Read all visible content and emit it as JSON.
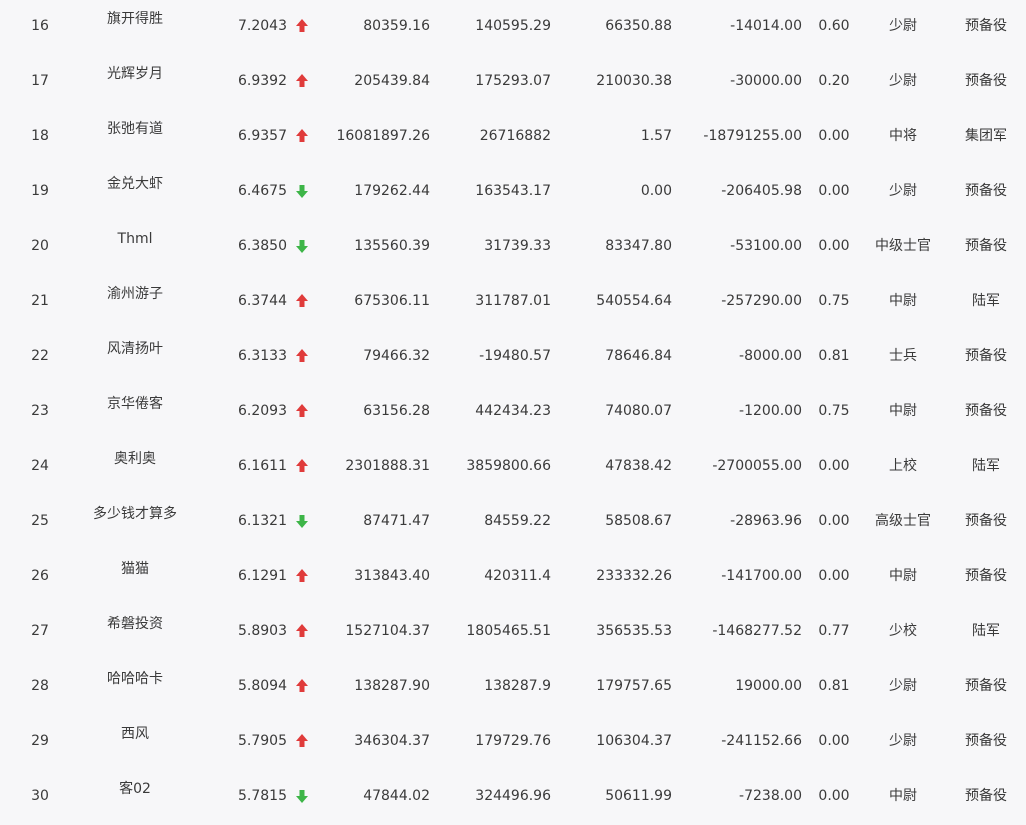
{
  "colors": {
    "up": "#e03b3b",
    "down": "#3db548"
  },
  "rows": [
    {
      "rank": "16",
      "name": "旗开得胜",
      "score": "7.2043",
      "trend": "up",
      "v1": "80359.16",
      "v2": "140595.29",
      "v3": "66350.88",
      "v4": "-14014.00",
      "ratio": "0.60",
      "rank_title": "少尉",
      "unit": "预备役"
    },
    {
      "rank": "17",
      "name": "光辉岁月",
      "score": "6.9392",
      "trend": "up",
      "v1": "205439.84",
      "v2": "175293.07",
      "v3": "210030.38",
      "v4": "-30000.00",
      "ratio": "0.20",
      "rank_title": "少尉",
      "unit": "预备役"
    },
    {
      "rank": "18",
      "name": "张弛有道",
      "score": "6.9357",
      "trend": "up",
      "v1": "16081897.26",
      "v2": "26716882",
      "v3": "1.57",
      "v4": "-18791255.00",
      "ratio": "0.00",
      "rank_title": "中将",
      "unit": "集团军"
    },
    {
      "rank": "19",
      "name": "金兑大虾",
      "score": "6.4675",
      "trend": "down",
      "v1": "179262.44",
      "v2": "163543.17",
      "v3": "0.00",
      "v4": "-206405.98",
      "ratio": "0.00",
      "rank_title": "少尉",
      "unit": "预备役"
    },
    {
      "rank": "20",
      "name": "Thml",
      "score": "6.3850",
      "trend": "down",
      "v1": "135560.39",
      "v2": "31739.33",
      "v3": "83347.80",
      "v4": "-53100.00",
      "ratio": "0.00",
      "rank_title": "中级士官",
      "unit": "预备役"
    },
    {
      "rank": "21",
      "name": "渝州游子",
      "score": "6.3744",
      "trend": "up",
      "v1": "675306.11",
      "v2": "311787.01",
      "v3": "540554.64",
      "v4": "-257290.00",
      "ratio": "0.75",
      "rank_title": "中尉",
      "unit": "陆军"
    },
    {
      "rank": "22",
      "name": "风清扬叶",
      "score": "6.3133",
      "trend": "up",
      "v1": "79466.32",
      "v2": "-19480.57",
      "v3": "78646.84",
      "v4": "-8000.00",
      "ratio": "0.81",
      "rank_title": "士兵",
      "unit": "预备役"
    },
    {
      "rank": "23",
      "name": "京华倦客",
      "score": "6.2093",
      "trend": "up",
      "v1": "63156.28",
      "v2": "442434.23",
      "v3": "74080.07",
      "v4": "-1200.00",
      "ratio": "0.75",
      "rank_title": "中尉",
      "unit": "预备役"
    },
    {
      "rank": "24",
      "name": "奥利奥",
      "score": "6.1611",
      "trend": "up",
      "v1": "2301888.31",
      "v2": "3859800.66",
      "v3": "47838.42",
      "v4": "-2700055.00",
      "ratio": "0.00",
      "rank_title": "上校",
      "unit": "陆军"
    },
    {
      "rank": "25",
      "name": "多少钱才算多",
      "score": "6.1321",
      "trend": "down",
      "v1": "87471.47",
      "v2": "84559.22",
      "v3": "58508.67",
      "v4": "-28963.96",
      "ratio": "0.00",
      "rank_title": "高级士官",
      "unit": "预备役"
    },
    {
      "rank": "26",
      "name": "猫猫",
      "score": "6.1291",
      "trend": "up",
      "v1": "313843.40",
      "v2": "420311.4",
      "v3": "233332.26",
      "v4": "-141700.00",
      "ratio": "0.00",
      "rank_title": "中尉",
      "unit": "预备役"
    },
    {
      "rank": "27",
      "name": "希磐投资",
      "score": "5.8903",
      "trend": "up",
      "v1": "1527104.37",
      "v2": "1805465.51",
      "v3": "356535.53",
      "v4": "-1468277.52",
      "ratio": "0.77",
      "rank_title": "少校",
      "unit": "陆军"
    },
    {
      "rank": "28",
      "name": "哈哈哈卡",
      "score": "5.8094",
      "trend": "up",
      "v1": "138287.90",
      "v2": "138287.9",
      "v3": "179757.65",
      "v4": "19000.00",
      "ratio": "0.81",
      "rank_title": "少尉",
      "unit": "预备役"
    },
    {
      "rank": "29",
      "name": "西风",
      "score": "5.7905",
      "trend": "up",
      "v1": "346304.37",
      "v2": "179729.76",
      "v3": "106304.37",
      "v4": "-241152.66",
      "ratio": "0.00",
      "rank_title": "少尉",
      "unit": "预备役"
    },
    {
      "rank": "30",
      "name": "客02",
      "score": "5.7815",
      "trend": "down",
      "v1": "47844.02",
      "v2": "324496.96",
      "v3": "50611.99",
      "v4": "-7238.00",
      "ratio": "0.00",
      "rank_title": "中尉",
      "unit": "预备役"
    }
  ]
}
